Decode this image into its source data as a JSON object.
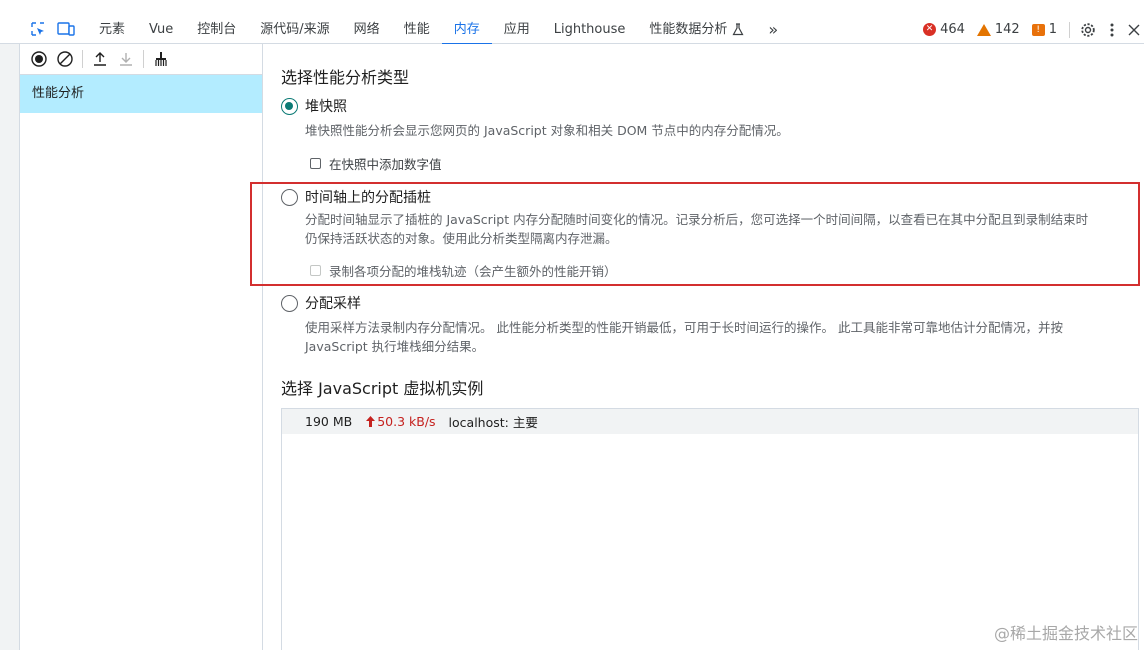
{
  "toolbar": {
    "tabs": [
      {
        "label": "元素",
        "active": false
      },
      {
        "label": "Vue",
        "active": false
      },
      {
        "label": "控制台",
        "active": false
      },
      {
        "label": "源代码/来源",
        "active": false
      },
      {
        "label": "网络",
        "active": false
      },
      {
        "label": "性能",
        "active": false
      },
      {
        "label": "内存",
        "active": true
      },
      {
        "label": "应用",
        "active": false
      },
      {
        "label": "Lighthouse",
        "active": false
      },
      {
        "label": "性能数据分析",
        "active": false
      }
    ],
    "more_label": "»",
    "errors": "464",
    "warnings": "142",
    "issues": "1"
  },
  "sidebar": {
    "item_label": "性能分析"
  },
  "main": {
    "profile_type_title": "选择性能分析类型",
    "options": [
      {
        "label": "堆快照",
        "selected": true,
        "description": "堆快照性能分析会显示您网页的 JavaScript 对象和相关 DOM 节点中的内存分配情况。",
        "checkbox": {
          "label": "在快照中添加数字值",
          "checked": false,
          "disabled": false
        }
      },
      {
        "label": "时间轴上的分配插桩",
        "selected": false,
        "description_line1": "分配时间轴显示了插桩的 JavaScript 内存分配随时间变化的情况。记录分析后，您可选择一个时间间隔，以查看已在其中分配且到录制结束时",
        "description_line2": "仍保持活跃状态的对象。使用此分析类型隔离内存泄漏。",
        "checkbox": {
          "label": "录制各项分配的堆栈轨迹（会产生额外的性能开销）",
          "checked": false,
          "disabled": true
        }
      },
      {
        "label": "分配采样",
        "selected": false,
        "description_line1": "使用采样方法录制内存分配情况。 此性能分析类型的性能开销最低，可用于长时间运行的操作。 此工具能非常可靠地估计分配情况，并按",
        "description_line2": "JavaScript 执行堆栈细分结果。"
      }
    ],
    "vm_title": "选择 JavaScript 虚拟机实例",
    "vm_instance": {
      "memory": "190 MB",
      "rate": "50.3 kB/s",
      "host": "localhost: 主要"
    }
  },
  "watermark": "@稀土掘金技术社区",
  "colors": {
    "accent": "#1a73e8",
    "radio_selected": "#0b7a75",
    "highlight_border": "#d32f2f",
    "rate_red": "#c5221f",
    "sidebar_selected": "#b3ecff"
  }
}
